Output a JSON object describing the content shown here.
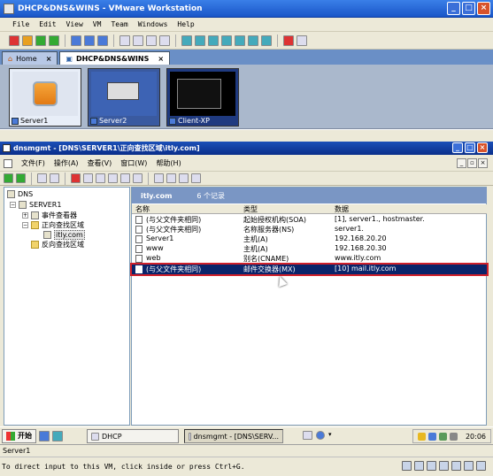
{
  "vmware": {
    "title": "DHCP&DNS&WINS - VMware Workstation",
    "menu": [
      "File",
      "Edit",
      "View",
      "VM",
      "Team",
      "Windows",
      "Help"
    ],
    "tabs": [
      {
        "label": "Home",
        "active": false
      },
      {
        "label": "DHCP&DNS&WINS",
        "active": true
      }
    ],
    "thumbnails": [
      {
        "label": "Server1"
      },
      {
        "label": "Server2"
      },
      {
        "label": "Client-XP"
      }
    ],
    "vm_name_status": "Server1",
    "status_hint": "To direct input to this VM, click inside or press Ctrl+G."
  },
  "mmc": {
    "title": "dnsmgmt - [DNS\\SERVER1\\正向查找区域\\itly.com]",
    "menu": [
      "文件(F)",
      "操作(A)",
      "查看(V)",
      "窗口(W)",
      "帮助(H)"
    ],
    "tree": {
      "root": "DNS",
      "server": "SERVER1",
      "event_viewer": "事件查看器",
      "forward_zones": "正向查找区域",
      "zone": "itly.com",
      "reverse_zones": "反向查找区域"
    },
    "pane_title": "itly.com",
    "record_count": "6 个记录",
    "columns": [
      "名称",
      "类型",
      "数据"
    ],
    "records": [
      {
        "name": "(与父文件夹相同)",
        "type": "起始授权机构(SOA)",
        "data": "[1], server1., hostmaster."
      },
      {
        "name": "(与父文件夹相同)",
        "type": "名称服务器(NS)",
        "data": "server1."
      },
      {
        "name": "Server1",
        "type": "主机(A)",
        "data": "192.168.20.20"
      },
      {
        "name": "www",
        "type": "主机(A)",
        "data": "192.168.20.30"
      },
      {
        "name": "web",
        "type": "别名(CNAME)",
        "data": "www.itly.com"
      },
      {
        "name": "(与父文件夹相同)",
        "type": "邮件交换器(MX)",
        "data": "[10]  mail.itly.com"
      }
    ]
  },
  "taskbar": {
    "start": "开始",
    "tasks": [
      "DHCP",
      "dnsmgmt - [DNS\\SERV..."
    ],
    "clock": "20:06"
  }
}
